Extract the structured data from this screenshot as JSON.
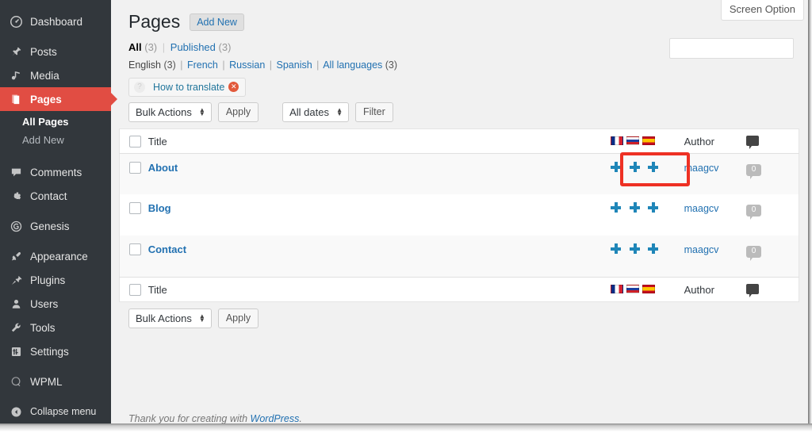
{
  "sidebar": {
    "items": [
      {
        "label": "Dashboard",
        "icon": "dashboard-icon",
        "current": false
      },
      {
        "label": "Posts",
        "icon": "pin-icon",
        "current": false
      },
      {
        "label": "Media",
        "icon": "media-icon",
        "current": false
      },
      {
        "label": "Pages",
        "icon": "pages-icon",
        "current": true
      },
      {
        "label": "Comments",
        "icon": "comment-icon",
        "current": false
      },
      {
        "label": "Contact",
        "icon": "gear-icon",
        "current": false
      },
      {
        "label": "Genesis",
        "icon": "genesis-icon",
        "current": false
      },
      {
        "label": "Appearance",
        "icon": "brush-icon",
        "current": false
      },
      {
        "label": "Plugins",
        "icon": "plug-icon",
        "current": false
      },
      {
        "label": "Users",
        "icon": "user-icon",
        "current": false
      },
      {
        "label": "Tools",
        "icon": "wrench-icon",
        "current": false
      },
      {
        "label": "Settings",
        "icon": "sliders-icon",
        "current": false
      },
      {
        "label": "WPML",
        "icon": "wpml-icon",
        "current": false
      }
    ],
    "submenu": [
      {
        "label": "All Pages",
        "current": true
      },
      {
        "label": "Add New",
        "current": false
      }
    ],
    "collapse_label": "Collapse menu",
    "collapse_icon": "collapse-arrow-icon"
  },
  "header": {
    "screen_options_label": "Screen Option",
    "page_title": "Pages",
    "add_new_label": "Add New"
  },
  "views": {
    "all_label": "All",
    "all_count": "(3)",
    "published_label": "Published",
    "published_count": "(3)",
    "separator": "|"
  },
  "languages": {
    "items": [
      {
        "label": "English",
        "count": "(3)",
        "active": true
      },
      {
        "label": "French",
        "count": "",
        "active": false
      },
      {
        "label": "Russian",
        "count": "",
        "active": false
      },
      {
        "label": "Spanish",
        "count": "",
        "active": false
      },
      {
        "label": "All languages",
        "count": "(3)",
        "active": false
      }
    ],
    "separator": "|"
  },
  "search": {
    "value": "",
    "placeholder": ""
  },
  "how_to_translate": {
    "label": "How to translate",
    "help_icon": "question-mark-icon",
    "close_icon": "close-circle-icon"
  },
  "tablenav_top": {
    "bulk_actions_label": "Bulk Actions",
    "apply_label": "Apply",
    "all_dates_label": "All dates",
    "filter_label": "Filter"
  },
  "tablenav_bottom": {
    "bulk_actions_label": "Bulk Actions",
    "apply_label": "Apply"
  },
  "table": {
    "columns": {
      "title": "Title",
      "author": "Author",
      "comments_icon": "comment-bubble-icon"
    },
    "flag_columns": [
      {
        "name": "french-flag-icon",
        "title": "French"
      },
      {
        "name": "russian-flag-icon",
        "title": "Russian"
      },
      {
        "name": "spanish-flag-icon",
        "title": "Spanish"
      }
    ],
    "rows": [
      {
        "title": "About",
        "author": "maagcv",
        "comments": "0",
        "translations": [
          "add-translation-french",
          "add-translation-russian",
          "add-translation-spanish"
        ],
        "highlighted": true
      },
      {
        "title": "Blog",
        "author": "maagcv",
        "comments": "0",
        "translations": [
          "add-translation-french",
          "add-translation-russian",
          "add-translation-spanish"
        ],
        "highlighted": false
      },
      {
        "title": "Contact",
        "author": "maagcv",
        "comments": "0",
        "translations": [
          "add-translation-french",
          "add-translation-russian",
          "add-translation-spanish"
        ],
        "highlighted": false
      }
    ]
  },
  "footer": {
    "text_before": "Thank you for creating with ",
    "link": "WordPress",
    "text_after": "."
  },
  "colors": {
    "sidebar_bg": "#32373c",
    "current_menu": "#e14d43",
    "link": "#2271b1",
    "plus_icon": "#1f86b8",
    "highlight_border": "#ee3124",
    "content_bg": "#f1f1f1"
  }
}
